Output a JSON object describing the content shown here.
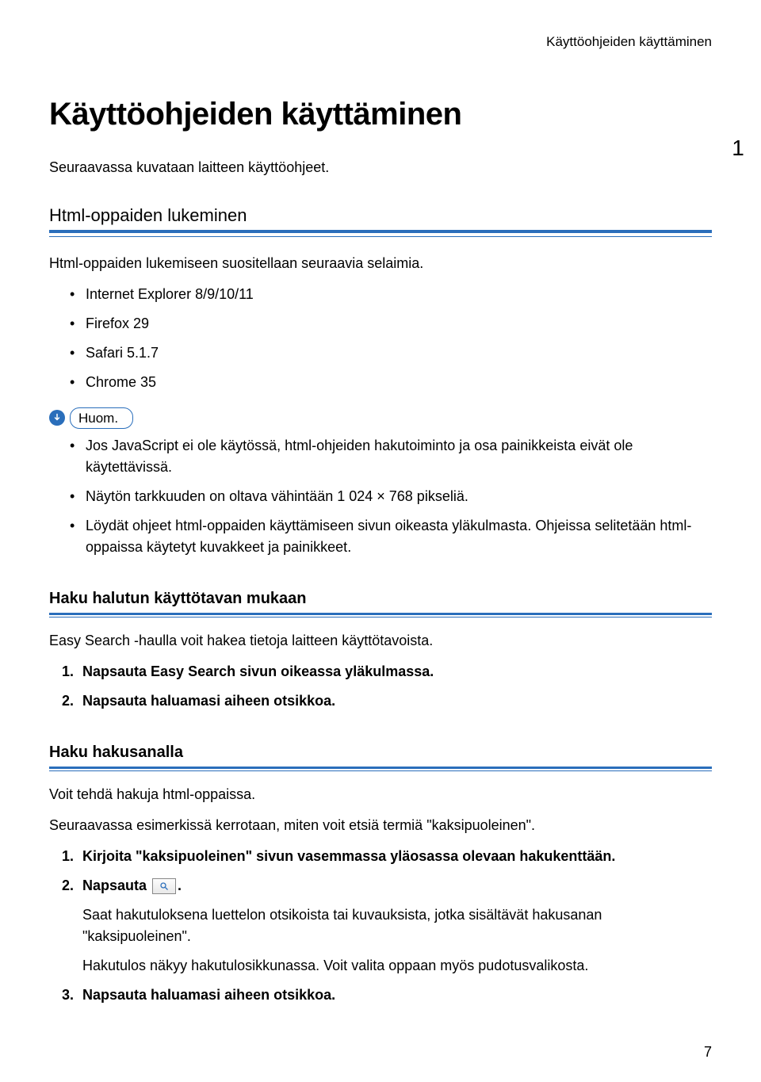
{
  "running_header": "Käyttöohjeiden käyttäminen",
  "chapter_number": "1",
  "main_title": "Käyttöohjeiden käyttäminen",
  "intro": "Seuraavassa kuvataan laitteen käyttöohjeet.",
  "section1": {
    "heading": "Html-oppaiden lukeminen",
    "body": "Html-oppaiden lukemiseen suositellaan seuraavia selaimia.",
    "browsers": [
      "Internet Explorer 8/9/10/11",
      "Firefox 29",
      "Safari 5.1.7",
      "Chrome 35"
    ],
    "note_label": "Huom.",
    "note_items": [
      "Jos JavaScript ei ole käytössä, html-ohjeiden hakutoiminto ja osa painikkeista eivät ole käytettävissä.",
      "Näytön tarkkuuden on oltava vähintään 1 024 × 768 pikseliä.",
      "Löydät ohjeet html-oppaiden käyttämiseen sivun oikeasta yläkulmasta. Ohjeissa selitetään html-oppaissa käytetyt kuvakkeet ja painikkeet."
    ]
  },
  "section2": {
    "heading": "Haku halutun käyttötavan mukaan",
    "body": "Easy Search -haulla voit hakea tietoja laitteen käyttötavoista.",
    "steps": [
      "Napsauta Easy Search sivun oikeassa yläkulmassa.",
      "Napsauta haluamasi aiheen otsikkoa."
    ]
  },
  "section3": {
    "heading": "Haku hakusanalla",
    "body1": "Voit tehdä hakuja html-oppaissa.",
    "body2": "Seuraavassa esimerkissä kerrotaan, miten voit etsiä termiä \"kaksipuoleinen\".",
    "step1": "Kirjoita \"kaksipuoleinen\" sivun vasemmassa yläosassa olevaan hakukenttään.",
    "step2_prefix": "Napsauta ",
    "step2_suffix": ".",
    "step2_sub1": "Saat hakutuloksena luettelon otsikoista tai kuvauksista, jotka sisältävät hakusanan \"kaksipuoleinen\".",
    "step2_sub2": "Hakutulos näkyy hakutulosikkunassa. Voit valita oppaan myös pudotusvalikosta.",
    "step3": "Napsauta haluamasi aiheen otsikkoa."
  },
  "page_number": "7"
}
